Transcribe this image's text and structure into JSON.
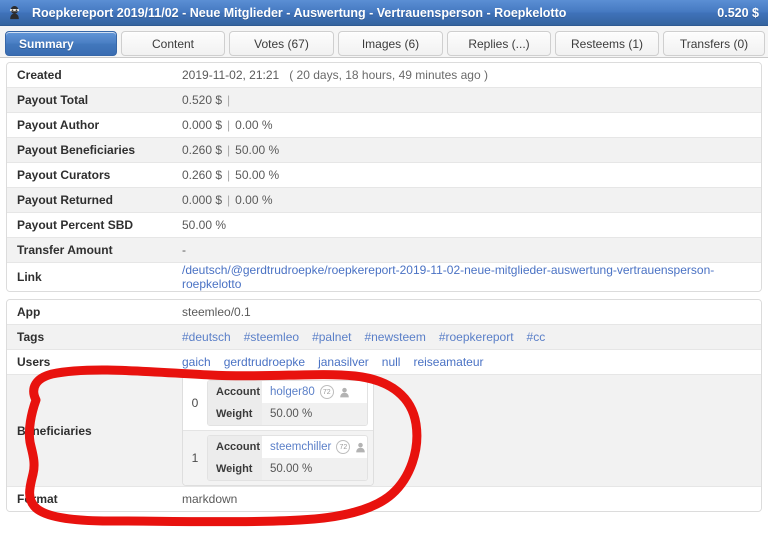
{
  "titlebar": {
    "avatar_icon": "ninja-avatar-icon",
    "avatar_glyph": "🥷",
    "title": "Roepkereport 2019/11/02 - Neue Mitglieder - Auswertung - Vertrauensperson - Roepkelotto",
    "payout": "0.520 $",
    "bg_color": "#4478c0"
  },
  "tabs": [
    {
      "label": "Summary",
      "name": "tab-summary",
      "active": true
    },
    {
      "label": "Content",
      "name": "tab-content",
      "active": false
    },
    {
      "label": "Votes (67)",
      "name": "tab-votes",
      "active": false
    },
    {
      "label": "Images (6)",
      "name": "tab-images",
      "active": false
    },
    {
      "label": "Replies (...)",
      "name": "tab-replies",
      "active": false
    },
    {
      "label": "Resteems (1)",
      "name": "tab-resteems",
      "active": false
    },
    {
      "label": "Transfers (0)",
      "name": "tab-transfers",
      "active": false
    }
  ],
  "summary": {
    "created": {
      "label": "Created",
      "datetime": "2019-11-02, 21:21",
      "ago": "( 20 days, 18 hours, 49 minutes ago )"
    },
    "payout_total": {
      "label": "Payout Total",
      "amount": "0.520  $",
      "sep": "|",
      "percent": ""
    },
    "payout_author": {
      "label": "Payout Author",
      "amount": "0.000  $",
      "sep": "|",
      "percent": "0.00  %"
    },
    "payout_beneficiaries": {
      "label": "Payout Beneficiaries",
      "amount": "0.260  $",
      "sep": "|",
      "percent": "50.00  %"
    },
    "payout_curators": {
      "label": "Payout Curators",
      "amount": "0.260  $",
      "sep": "|",
      "percent": "50.00  %"
    },
    "payout_returned": {
      "label": "Payout Returned",
      "amount": "0.000  $",
      "sep": "|",
      "percent": "0.00  %"
    },
    "payout_percent_sbd": {
      "label": "Payout Percent SBD",
      "value": "50.00  %"
    },
    "transfer_amount": {
      "label": "Transfer Amount",
      "value": "-"
    },
    "link": {
      "label": "Link",
      "url_text": "/deutsch/@gerdtrudroepke/roepkereport-2019-11-02-neue-mitglieder-auswertung-vertrauensperson-roepkelotto"
    }
  },
  "meta": {
    "app": {
      "label": "App",
      "value": "steemleo/0.1"
    },
    "tags": {
      "label": "Tags",
      "items": [
        "#deutsch",
        "#steemleo",
        "#palnet",
        "#newsteem",
        "#roepkereport",
        "#cc"
      ]
    },
    "users": {
      "label": "Users",
      "items": [
        "gaich",
        "gerdtrudroepke",
        "janasilver",
        "null",
        "reiseamateur"
      ]
    },
    "beneficiaries": {
      "label": "Beneficiaries",
      "account_label": "Account",
      "weight_label": "Weight",
      "items": [
        {
          "index": "0",
          "account": "holger80",
          "reputation": "72",
          "weight": "50.00 %",
          "person_icon": "person-icon"
        },
        {
          "index": "1",
          "account": "steemchiller",
          "reputation": "72",
          "weight": "50.00 %",
          "person_icon": "person-icon"
        }
      ]
    },
    "format": {
      "label": "Format",
      "value": "markdown"
    }
  },
  "annotation": {
    "name": "red-highlight-ellipse",
    "color": "#e8120e",
    "target": "Beneficiaries row"
  }
}
